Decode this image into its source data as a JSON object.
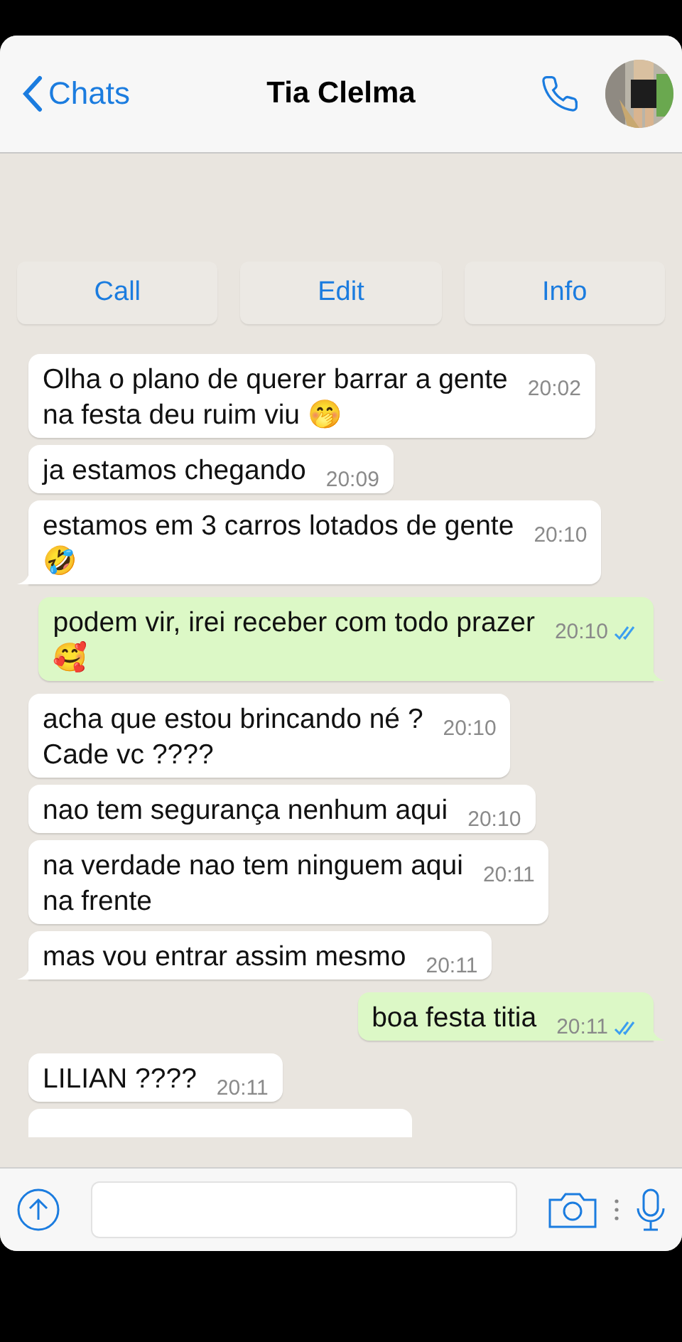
{
  "header": {
    "back": "Chats",
    "title": "Tia Clelma"
  },
  "actions": [
    "Call",
    "Edit",
    "Info"
  ],
  "messages": [
    {
      "kind": "in",
      "text": "Olha o plano de querer barrar a gente\nna festa deu ruim viu 🤭",
      "time": "20:02",
      "tail": false
    },
    {
      "kind": "in",
      "text": "ja estamos chegando",
      "time": "20:09",
      "tail": false
    },
    {
      "kind": "in",
      "text": "estamos em 3 carros lotados de gente\n🤣",
      "time": "20:10",
      "tail": true
    },
    {
      "kind": "out",
      "text": "podem vir, irei receber com todo prazer\n🥰",
      "time": "20:10",
      "read": true,
      "tail": true
    },
    {
      "kind": "in",
      "text": "acha que estou brincando né ?\nCade vc ????",
      "time": "20:10",
      "tail": false
    },
    {
      "kind": "in",
      "text": "nao tem segurança nenhum aqui",
      "time": "20:10",
      "tail": false
    },
    {
      "kind": "in",
      "text": "na verdade nao tem ninguem aqui\nna frente",
      "time": "20:11",
      "tail": false
    },
    {
      "kind": "in",
      "text": "mas vou entrar assim mesmo",
      "time": "20:11",
      "tail": true
    },
    {
      "kind": "out",
      "text": "boa festa titia",
      "time": "20:11",
      "read": true,
      "tail": true
    },
    {
      "kind": "in",
      "text": "LILIAN ????",
      "time": "20:11",
      "tail": false
    },
    {
      "kind": "cut"
    }
  ]
}
